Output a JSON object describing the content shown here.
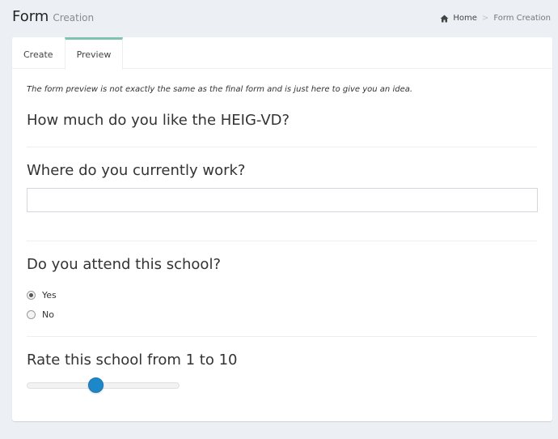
{
  "header": {
    "title": "Form",
    "subtitle": "Creation",
    "breadcrumb": {
      "home": "Home",
      "separator": ">",
      "current": "Form Creation"
    }
  },
  "tabs": [
    {
      "label": "Create",
      "active": false
    },
    {
      "label": "Preview",
      "active": true
    }
  ],
  "preview": {
    "note": "The form preview is not exactly the same as the final form and is just here to give you an idea.",
    "questions": [
      {
        "label": "How much do you like the HEIG-VD?",
        "type": "none"
      },
      {
        "label": "Where do you currently work?",
        "type": "text",
        "value": "",
        "placeholder": ""
      },
      {
        "label": "Do you attend this school?",
        "type": "radio",
        "options": [
          {
            "label": "Yes",
            "checked": true
          },
          {
            "label": "No",
            "checked": false
          }
        ]
      },
      {
        "label": "Rate this school from 1 to 10",
        "type": "slider",
        "min": 1,
        "max": 10,
        "value": 5
      }
    ]
  },
  "colors": {
    "accent_tab": "#7cc4b1",
    "slider_handle": "#1c87c9",
    "background": "#ecf0f5"
  },
  "icons": {
    "home": "home-icon"
  }
}
